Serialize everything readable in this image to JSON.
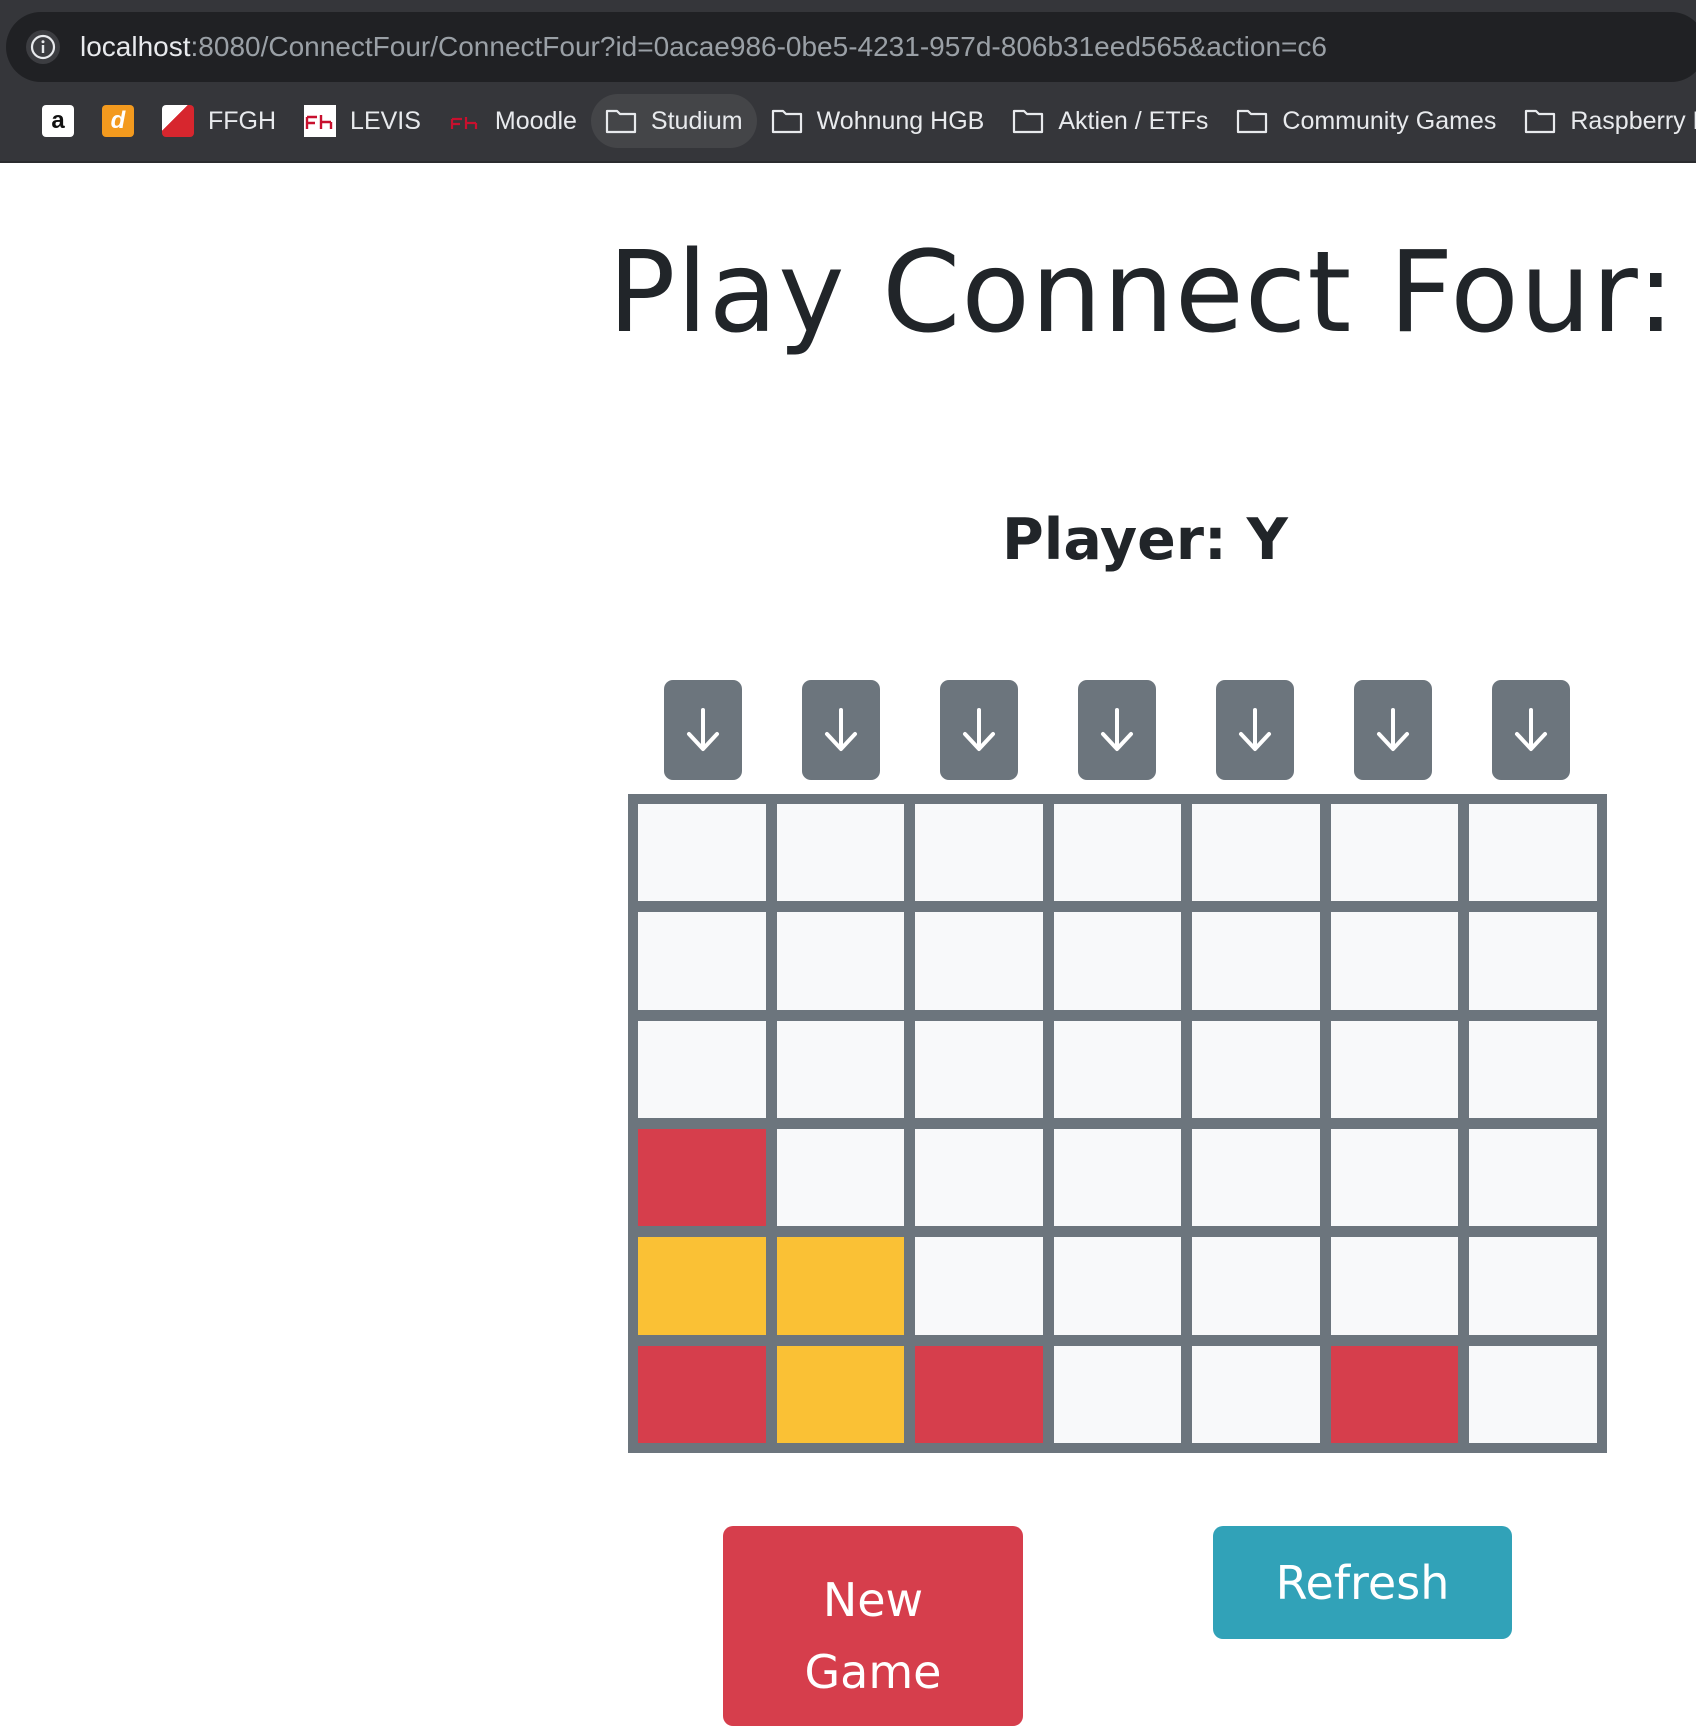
{
  "browser": {
    "url_host": "localhost",
    "url_rest": ":8080/ConnectFour/ConnectFour?id=0acae986-0be5-4231-957d-806b31eed565&action=c6",
    "bookmarks": [
      {
        "label": "",
        "icon": "amazon-favicon"
      },
      {
        "label": "",
        "icon": "d-favicon"
      },
      {
        "label": "FFGH",
        "icon": "ffgh-favicon"
      },
      {
        "label": "LEVIS",
        "icon": "fh-favicon"
      },
      {
        "label": "Moodle",
        "icon": "fh-favicon"
      },
      {
        "label": "Studium",
        "icon": "folder-icon",
        "active": true
      },
      {
        "label": "Wohnung HGB",
        "icon": "folder-icon"
      },
      {
        "label": "Aktien / ETFs",
        "icon": "folder-icon"
      },
      {
        "label": "Community Games",
        "icon": "folder-icon"
      },
      {
        "label": "Raspberry P",
        "icon": "folder-icon"
      }
    ]
  },
  "page": {
    "title": "Play Connect Four:",
    "player_label": "Player: Y"
  },
  "game": {
    "columns": 7,
    "rows": 6,
    "drop_icon": "↓",
    "board": [
      [
        "",
        "",
        "",
        "",
        "",
        "",
        ""
      ],
      [
        "",
        "",
        "",
        "",
        "",
        "",
        ""
      ],
      [
        "",
        "",
        "",
        "",
        "",
        "",
        ""
      ],
      [
        "R",
        "",
        "",
        "",
        "",
        "",
        ""
      ],
      [
        "Y",
        "Y",
        "",
        "",
        "",
        "",
        ""
      ],
      [
        "R",
        "Y",
        "R",
        "",
        "",
        "R",
        ""
      ]
    ],
    "colors": {
      "R": "#d63e4c",
      "Y": "#fac135",
      "empty": "#f8f9fa",
      "board": "#6c757d"
    }
  },
  "actions": {
    "new_game_label": "New Game",
    "refresh_label": "Refresh"
  }
}
